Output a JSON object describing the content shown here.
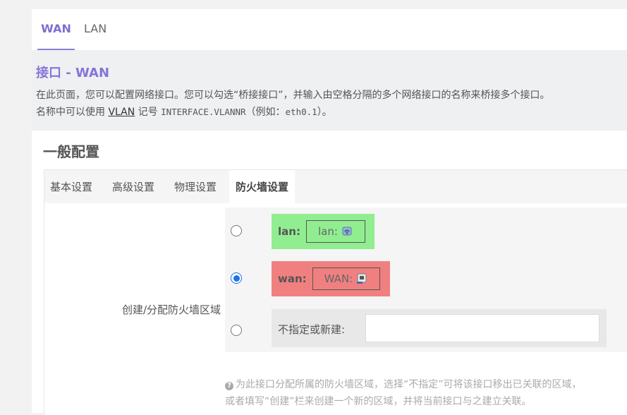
{
  "tabs": [
    {
      "label": "WAN",
      "active": true
    },
    {
      "label": "LAN",
      "active": false
    }
  ],
  "page": {
    "title": "接口 - WAN",
    "desc_line1": "在此页面，您可以配置网络接口。您可以勾选“桥接接口”，并输入由空格分隔的多个网络接口的名称来桥接多个接口。",
    "desc_line2_prefix": "名称中可以使用 ",
    "desc_line2_link": "VLAN",
    "desc_line2_mid": " 记号 ",
    "desc_line2_code1": "INTERFACE.VLANNR",
    "desc_line2_paren": "（例如：",
    "desc_line2_code2": "eth0.1",
    "desc_line2_end": "）。"
  },
  "section": {
    "title": "一般配置",
    "subtabs": [
      "基本设置",
      "高级设置",
      "物理设置",
      "防火墙设置"
    ],
    "active_subtab": "防火墙设置"
  },
  "firewall": {
    "field_label": "创建/分配防火墙区域",
    "zones": [
      {
        "name": "lan:",
        "network_label": "lan:",
        "color": "#90ee90",
        "selected": false,
        "icon": "network-icon"
      },
      {
        "name": "wan:",
        "network_label": "WAN:",
        "color": "#f08080",
        "selected": true,
        "icon": "network-icon"
      }
    ],
    "new_zone_label": "不指定或新建:",
    "new_zone_value": "",
    "help_line1": "为此接口分配所属的防火墙区域，选择“不指定”可将该接口移出已关联的区域，",
    "help_line2": "或者填写“创建”栏来创建一个新的区域，并将当前接口与之建立关联。"
  }
}
